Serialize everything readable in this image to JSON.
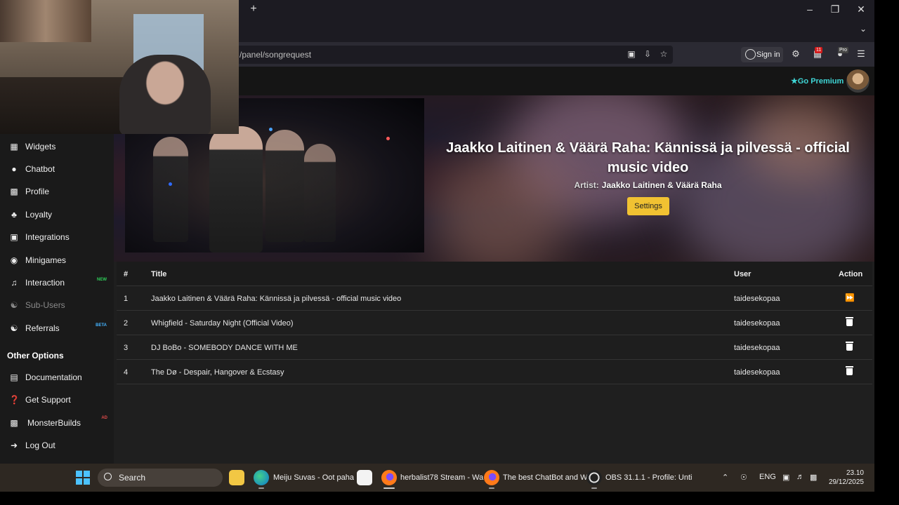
{
  "browser": {
    "url_fragment": "/panel/songrequest",
    "sign_in_label": "Sign in",
    "extension_badge_1": "11",
    "extension_badge_2": "Pro"
  },
  "header": {
    "premium_label": "Go Premium"
  },
  "sidebar": {
    "items": [
      {
        "label": "Widgets",
        "icon": "grid-icon"
      },
      {
        "label": "Chatbot",
        "icon": "robot-icon"
      },
      {
        "label": "Profile",
        "icon": "id-card-icon"
      },
      {
        "label": "Loyalty",
        "icon": "trophy-icon"
      },
      {
        "label": "Integrations",
        "icon": "window-icon"
      },
      {
        "label": "Minigames",
        "icon": "gamepad-icon"
      },
      {
        "label": "Interaction",
        "icon": "music-icon",
        "tag": "NEW"
      },
      {
        "label": "Sub-Users",
        "icon": "users-icon",
        "disabled": true
      },
      {
        "label": "Referrals",
        "icon": "users-icon",
        "tag": "BETA"
      }
    ],
    "section_title": "Other Options",
    "other_items": [
      {
        "label": "Documentation",
        "icon": "scroll-icon"
      },
      {
        "label": "Get Support",
        "icon": "question-icon"
      },
      {
        "label": "MonsterBuilds",
        "icon": "laptop-icon",
        "tag": "AD"
      },
      {
        "label": "Log Out",
        "icon": "logout-icon"
      }
    ]
  },
  "now_playing": {
    "title": "Jaakko Laitinen & Väärä Raha: Kännissä ja pilvessä - official music video",
    "artist_label": "Artist:",
    "artist": "Jaakko Laitinen & Väärä Raha",
    "settings_label": "Settings"
  },
  "queue": {
    "headers": {
      "num": "#",
      "title": "Title",
      "user": "User",
      "action": "Action"
    },
    "rows": [
      {
        "num": "1",
        "title": "Jaakko Laitinen & Väärä Raha: Kännissä ja pilvessä - official music video",
        "user": "taidesekopaa",
        "action": "skip"
      },
      {
        "num": "2",
        "title": "Whigfield - Saturday Night (Official Video)",
        "user": "taidesekopaa",
        "action": "delete"
      },
      {
        "num": "3",
        "title": "DJ BoBo - SOMEBODY DANCE WITH ME",
        "user": "taidesekopaa",
        "action": "delete"
      },
      {
        "num": "4",
        "title": "The Dø - Despair, Hangover & Ecstasy",
        "user": "taidesekopaa",
        "action": "delete"
      }
    ]
  },
  "taskbar": {
    "search_label": "Search",
    "apps": [
      {
        "label": "Meiju Suvas - Oot paha"
      },
      {
        "label": "herbalist78 Stream - Wa"
      },
      {
        "label": "The best ChatBot and W"
      },
      {
        "label": "OBS 31.1.1 - Profile: Unti"
      }
    ],
    "language": "ENG",
    "time": "23.10",
    "date": "29/12/2025"
  },
  "colors": {
    "accent": "#f1c232",
    "premium": "#3fd6d6",
    "new_tag": "#2fd05a",
    "beta_tag": "#44b3ff"
  }
}
